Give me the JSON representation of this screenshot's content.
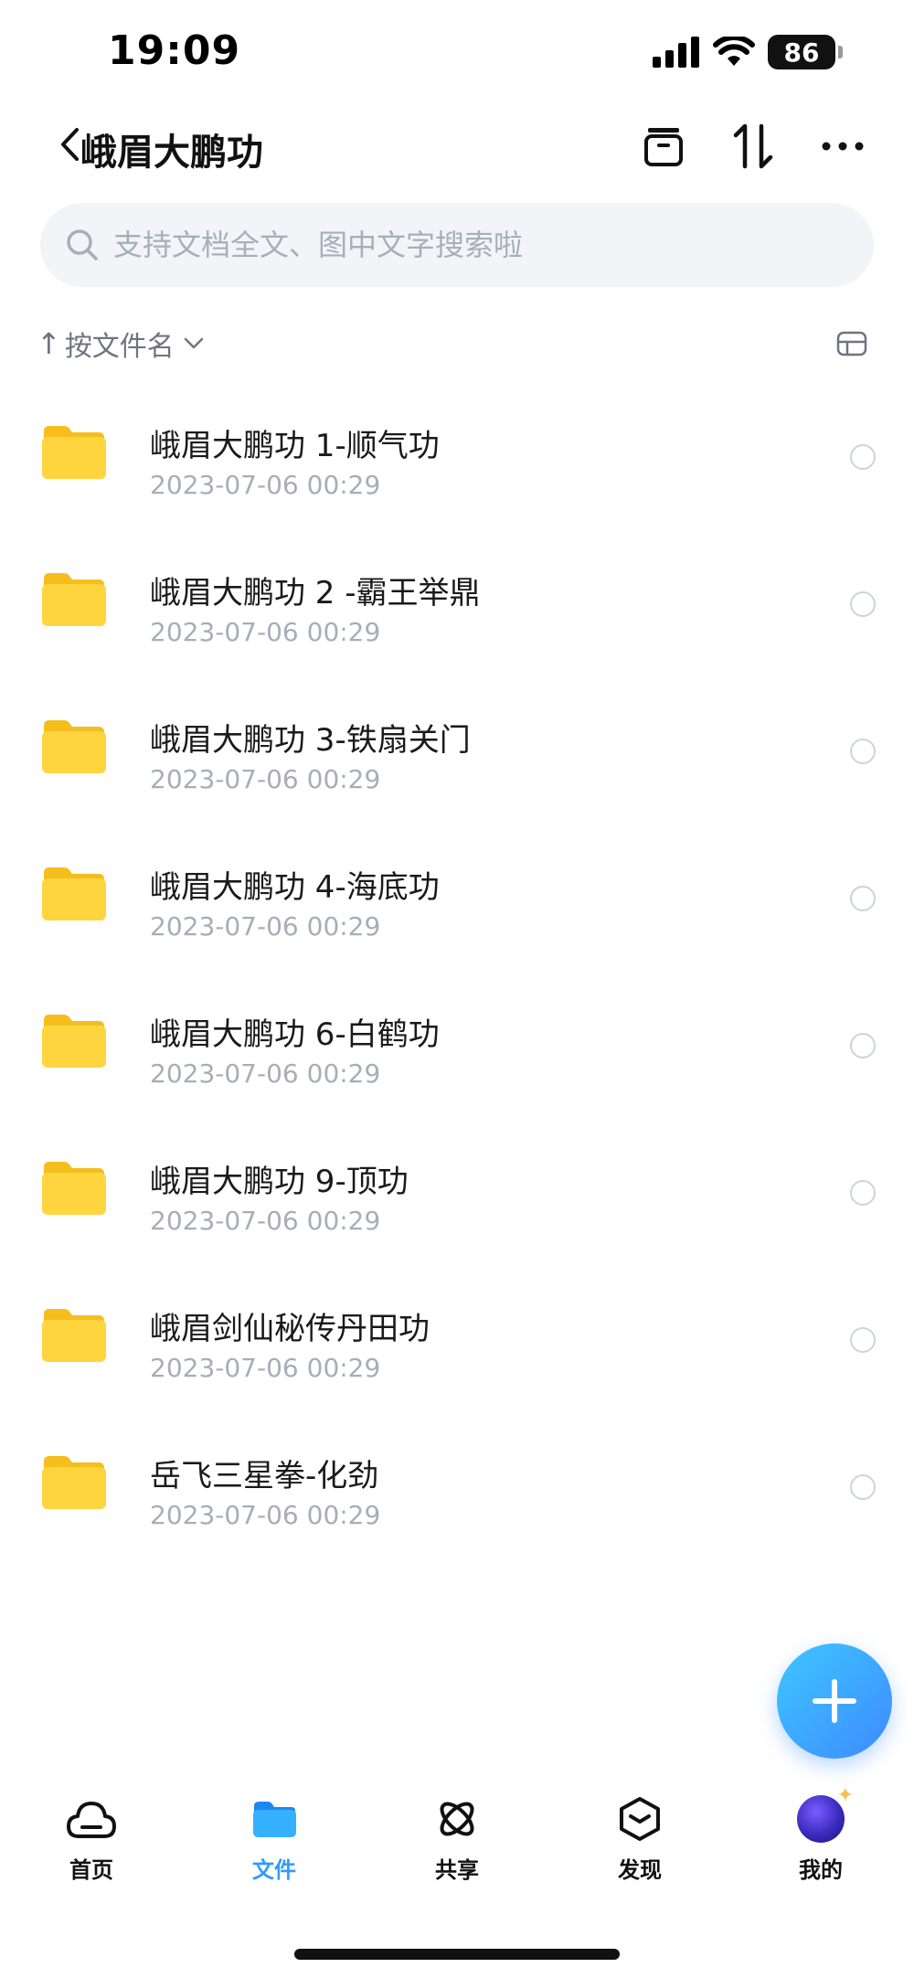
{
  "status_bar": {
    "time": "19:09",
    "battery": "86"
  },
  "nav": {
    "title": "峨眉大鹏功",
    "icons": [
      "back-icon",
      "archive-icon",
      "sort-icon",
      "more-icon"
    ]
  },
  "search": {
    "placeholder": "支持文档全文、图中文字搜索啦"
  },
  "sort": {
    "arrow": "↑",
    "label": "按文件名"
  },
  "files": [
    {
      "name": "峨眉大鹏功 1-顺气功",
      "date": "2023-07-06 00:29"
    },
    {
      "name": "峨眉大鹏功 2 -霸王举鼎",
      "date": "2023-07-06 00:29"
    },
    {
      "name": "峨眉大鹏功 3-铁扇关门",
      "date": "2023-07-06 00:29"
    },
    {
      "name": "峨眉大鹏功 4-海底功",
      "date": "2023-07-06 00:29"
    },
    {
      "name": "峨眉大鹏功 6-白鹤功",
      "date": "2023-07-06 00:29"
    },
    {
      "name": "峨眉大鹏功 9-顶功",
      "date": "2023-07-06 00:29"
    },
    {
      "name": "峨眉剑仙秘传丹田功",
      "date": "2023-07-06 00:29"
    },
    {
      "name": "岳飞三星拳-化劲",
      "date": "2023-07-06 00:29"
    }
  ],
  "tabs": [
    {
      "label": "首页",
      "icon": "cloud-icon",
      "active": false
    },
    {
      "label": "文件",
      "icon": "folder-icon",
      "active": true
    },
    {
      "label": "共享",
      "icon": "orbit-icon",
      "active": false
    },
    {
      "label": "发现",
      "icon": "cube-icon",
      "active": false
    },
    {
      "label": "我的",
      "icon": "avatar",
      "active": false
    }
  ],
  "colors": {
    "accent": "#2f9bff",
    "folder": "#ffd23f",
    "search_bg": "#f2f4f8"
  }
}
